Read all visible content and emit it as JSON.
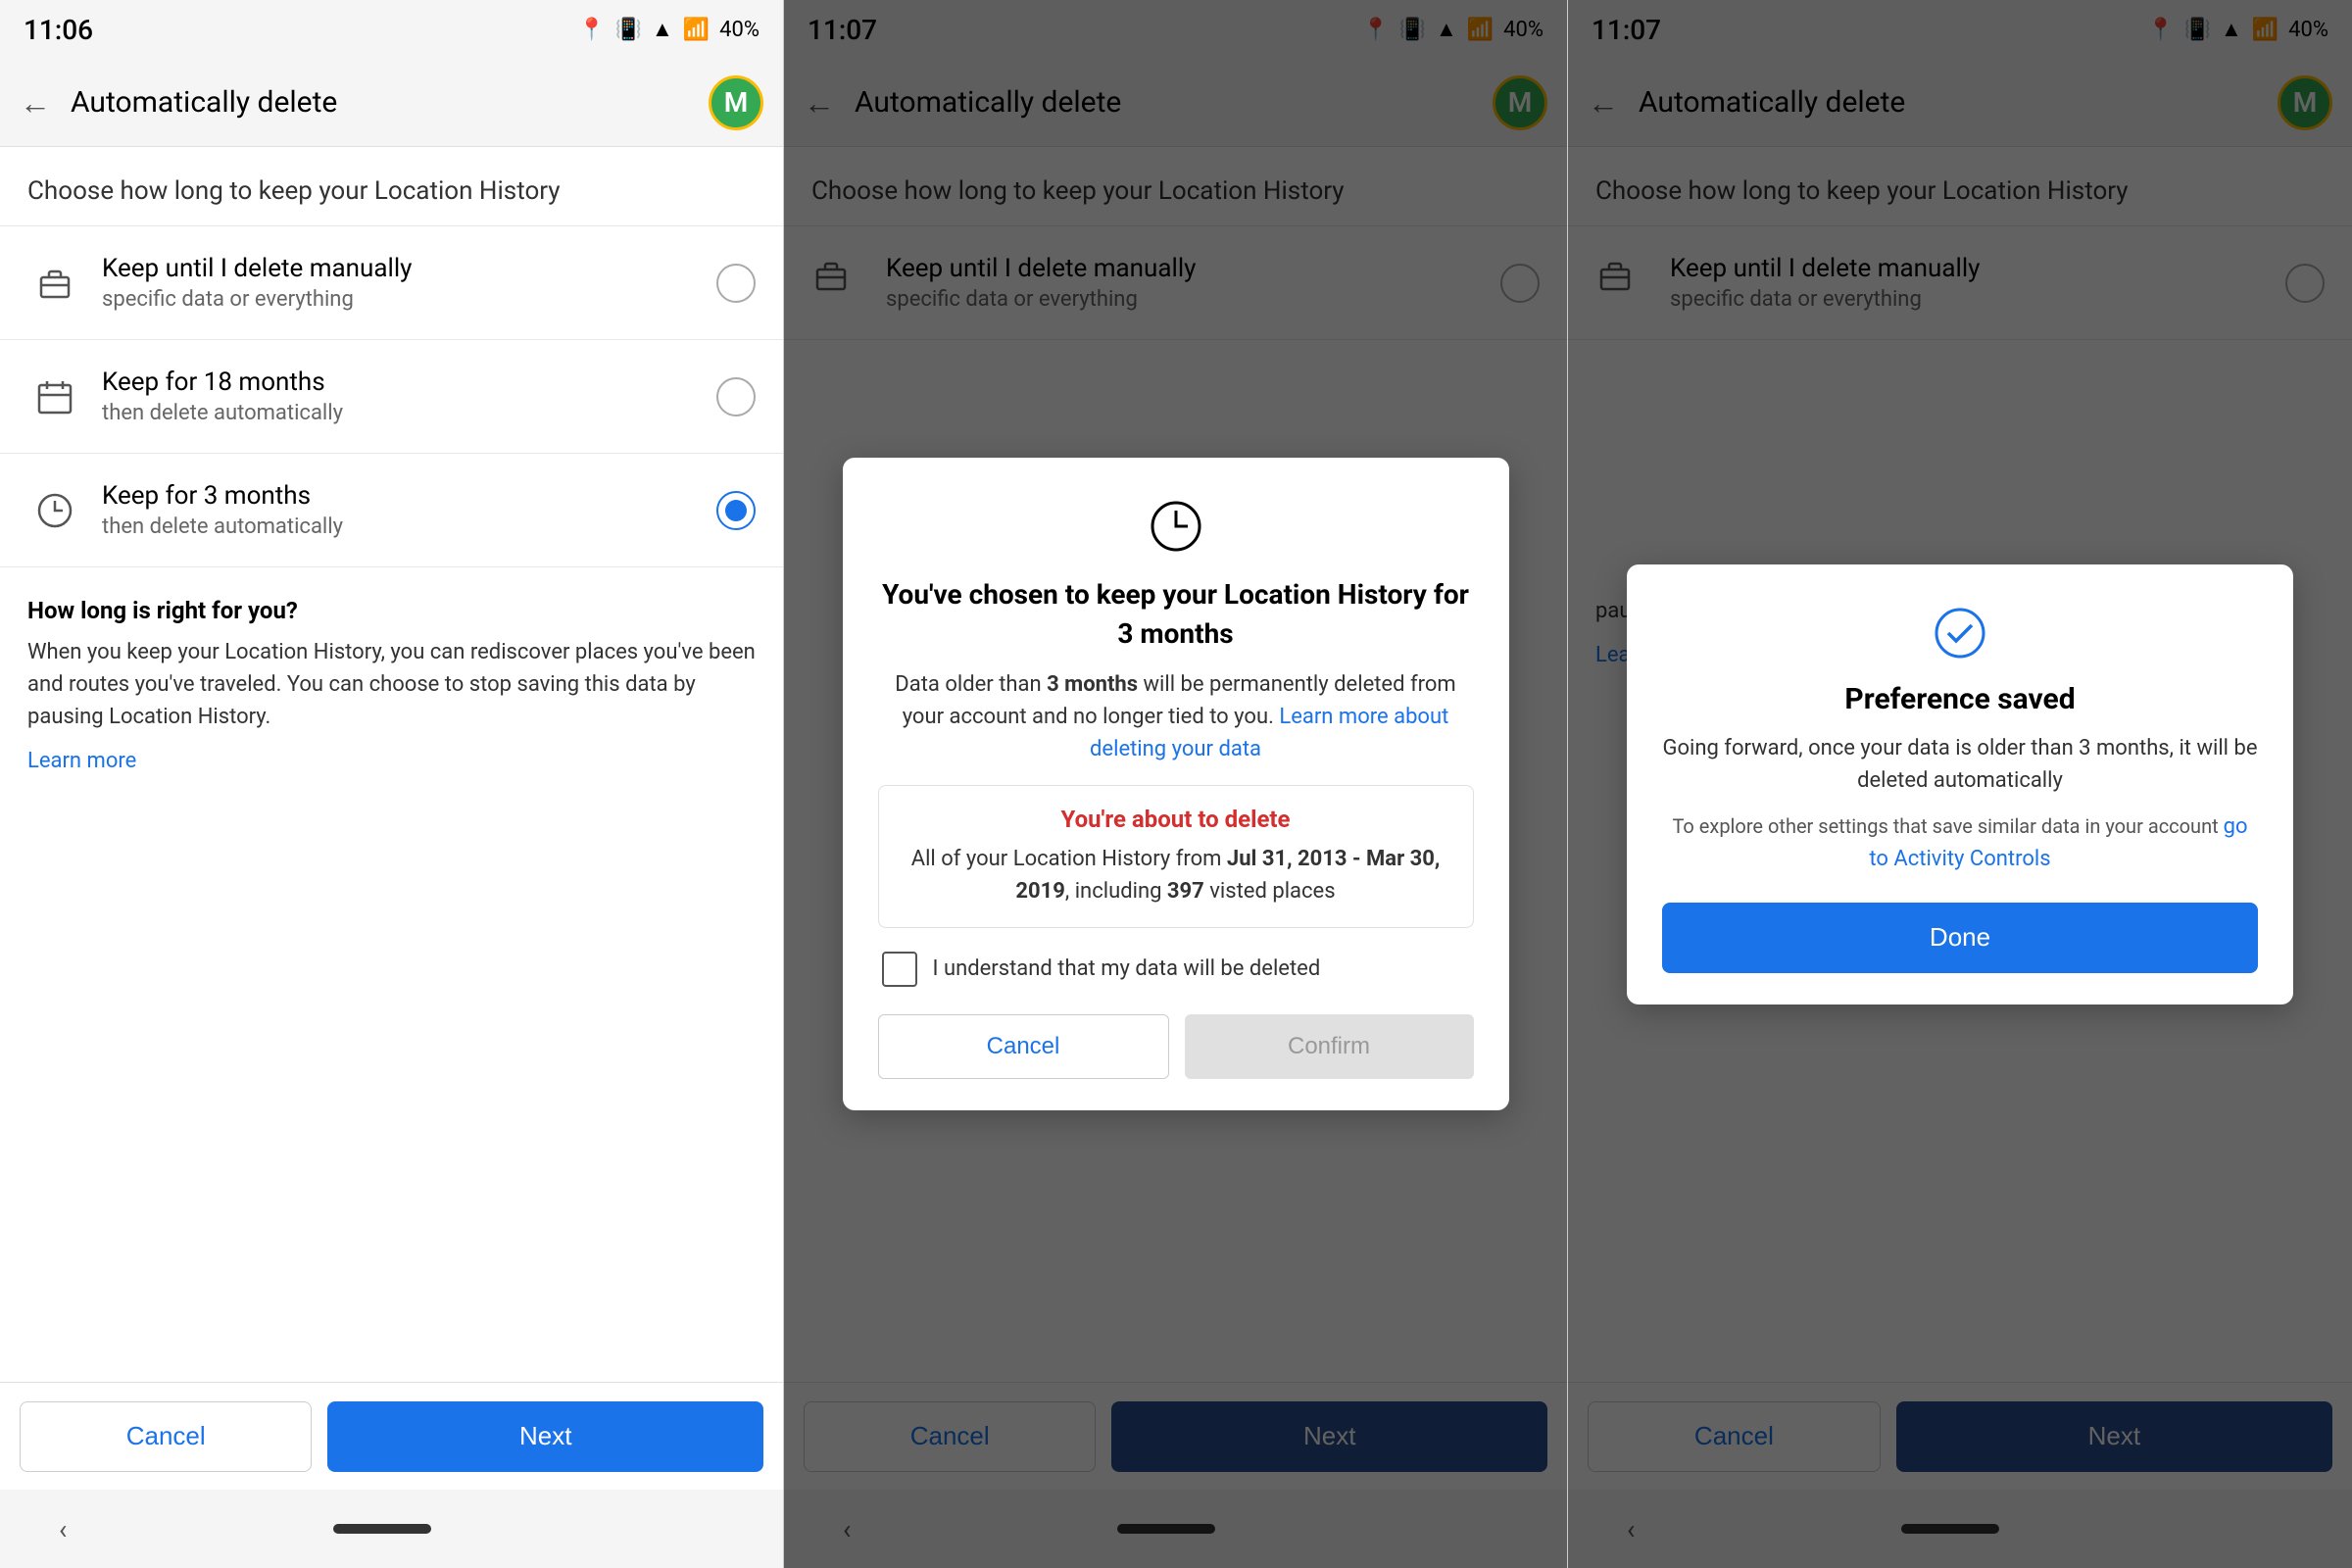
{
  "panels": [
    {
      "id": "panel1",
      "status": {
        "time": "11:06",
        "battery": "40%"
      },
      "appbar": {
        "title": "Automatically delete",
        "avatar_letter": "M"
      },
      "page_title": "Choose how long to keep your Location History",
      "options": [
        {
          "id": "opt1",
          "icon": "briefcase",
          "title": "Keep until I delete manually",
          "subtitle": "specific data or everything",
          "selected": false
        },
        {
          "id": "opt2",
          "icon": "calendar",
          "title": "Keep for 18 months",
          "subtitle": "then delete automatically",
          "selected": false
        },
        {
          "id": "opt3",
          "icon": "clock",
          "title": "Keep for 3 months",
          "subtitle": "then delete automatically",
          "selected": true
        }
      ],
      "info": {
        "title": "How long is right for you?",
        "text": "When you keep your Location History, you can rediscover places you've been and routes you've traveled. You can choose to stop saving this data by pausing Location History.",
        "learn_more": "Learn more"
      },
      "buttons": {
        "cancel": "Cancel",
        "next": "Next"
      }
    },
    {
      "id": "panel2",
      "status": {
        "time": "11:07",
        "battery": "40%"
      },
      "appbar": {
        "title": "Automatically delete",
        "avatar_letter": "M"
      },
      "page_title": "Choose how long to keep your Location History",
      "modal": {
        "type": "confirm",
        "icon": "clock",
        "title": "You've chosen to keep your Location History for 3 months",
        "desc": "Data older than ",
        "desc_bold": "3 months",
        "desc_rest": " will be permanently deleted from your account and no longer tied to you.",
        "learn_more": "Learn more about deleting your data",
        "warning_title": "You're about to delete",
        "warning_text": "All of your Location History from ",
        "warning_bold1": "Jul 31, 2013 - Mar 30, 2019",
        "warning_bold2": "397",
        "warning_suffix": " visted places",
        "warning_mid": ", including ",
        "checkbox_label": "I understand that my data will be deleted",
        "cancel": "Cancel",
        "confirm": "Confirm"
      },
      "buttons": {
        "cancel": "Cancel",
        "next": "Next"
      }
    },
    {
      "id": "panel3",
      "status": {
        "time": "11:07",
        "battery": "40%"
      },
      "appbar": {
        "title": "Automatically delete",
        "avatar_letter": "M"
      },
      "page_title": "Choose how long to keep your Location History",
      "options": [
        {
          "id": "opt1",
          "icon": "briefcase",
          "title": "Keep until I delete manually",
          "subtitle": "specific data or everything",
          "selected": false
        }
      ],
      "pref_modal": {
        "icon": "checkmark-circle",
        "title": "Preference saved",
        "desc": "Going forward, once your data is older than 3 months, it will be deleted automatically",
        "subdesc_pre": "To explore other settings that save similar data in your account ",
        "subdesc_link": "go to Activity Controls",
        "done": "Done"
      },
      "info": {
        "text": "pausing Location History.",
        "learn_more": "Learn more"
      },
      "buttons": {
        "cancel": "Cancel",
        "next": "Next"
      }
    }
  ]
}
